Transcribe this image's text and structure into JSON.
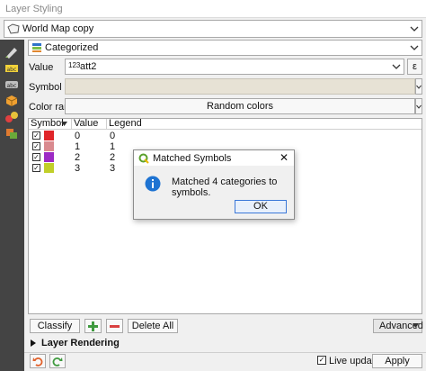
{
  "window": {
    "title": "Layer Styling"
  },
  "layer_selector": {
    "value": "World Map copy"
  },
  "renderer": {
    "value": "Categorized"
  },
  "value_row": {
    "label": "Value",
    "type_prefix": "123",
    "field": "att2"
  },
  "symbol_row": {
    "label": "Symbol"
  },
  "color_ramp_row": {
    "label": "Color ramp",
    "button": "Random colors"
  },
  "table": {
    "headers": {
      "symbol": "Symbol",
      "value": "Value",
      "legend": "Legend"
    },
    "rows": [
      {
        "value": "0",
        "legend": "0",
        "color": "#e0252a"
      },
      {
        "value": "1",
        "legend": "1",
        "color": "#d98a8f"
      },
      {
        "value": "2",
        "legend": "2",
        "color": "#9d2ac4"
      },
      {
        "value": "3",
        "legend": "3",
        "color": "#c1cf2a"
      }
    ]
  },
  "buttons": {
    "classify": "Classify",
    "delete_all": "Delete All",
    "advanced": "Advanced",
    "apply": "Apply"
  },
  "layer_rendering": {
    "label": "Layer Rendering"
  },
  "live_update": {
    "label": "Live update"
  },
  "dialog": {
    "title": "Matched Symbols",
    "message": "Matched 4 categories to symbols.",
    "ok": "OK"
  },
  "colors": {
    "sidebar": "#444444",
    "accent": "#3b78d8",
    "info_icon": "#1e73d2"
  }
}
